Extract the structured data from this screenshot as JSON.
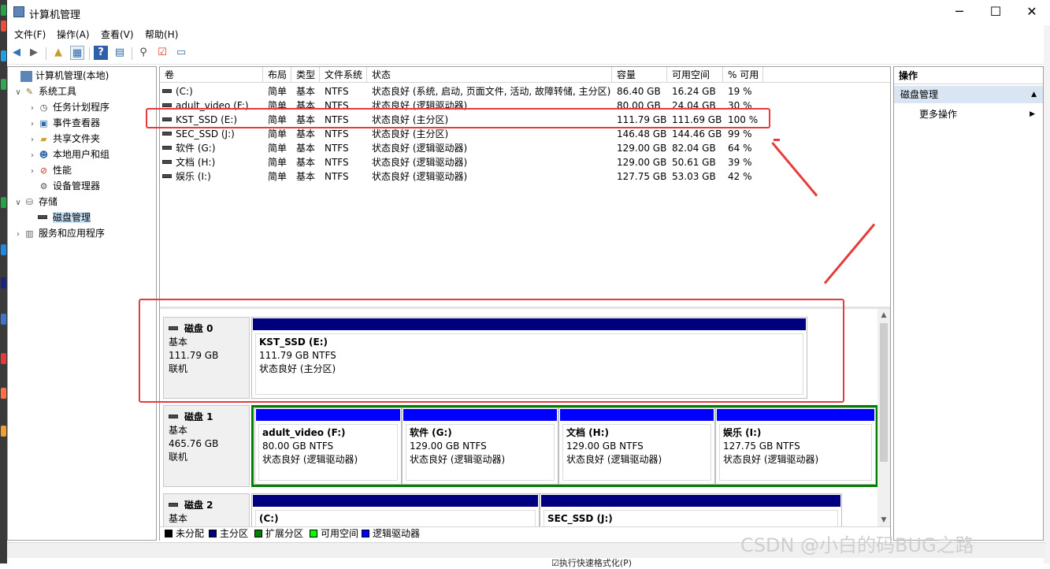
{
  "window": {
    "title": "计算机管理"
  },
  "menu": [
    "文件(F)",
    "操作(A)",
    "查看(V)",
    "帮助(H)"
  ],
  "tree": {
    "root": "计算机管理(本地)",
    "system_tools": "系统工具",
    "task_scheduler": "任务计划程序",
    "event_viewer": "事件查看器",
    "shared_folders": "共享文件夹",
    "local_users": "本地用户和组",
    "performance": "性能",
    "device_manager": "设备管理器",
    "storage": "存储",
    "disk_management": "磁盘管理",
    "services_apps": "服务和应用程序"
  },
  "columns": [
    "卷",
    "布局",
    "类型",
    "文件系统",
    "状态",
    "容量",
    "可用空间",
    "% 可用"
  ],
  "volumes": [
    {
      "name": "(C:)",
      "layout": "简单",
      "type": "基本",
      "fs": "NTFS",
      "status": "状态良好 (系统, 启动, 页面文件, 活动, 故障转储, 主分区)",
      "capacity": "86.40 GB",
      "free": "16.24 GB",
      "pct": "19 %"
    },
    {
      "name": "adult_video (F:)",
      "layout": "简单",
      "type": "基本",
      "fs": "NTFS",
      "status": "状态良好 (逻辑驱动器)",
      "capacity": "80.00 GB",
      "free": "24.04 GB",
      "pct": "30 %"
    },
    {
      "name": "KST_SSD (E:)",
      "layout": "简单",
      "type": "基本",
      "fs": "NTFS",
      "status": "状态良好 (主分区)",
      "capacity": "111.79 GB",
      "free": "111.69 GB",
      "pct": "100 %"
    },
    {
      "name": "SEC_SSD (J:)",
      "layout": "简单",
      "type": "基本",
      "fs": "NTFS",
      "status": "状态良好 (主分区)",
      "capacity": "146.48 GB",
      "free": "144.46 GB",
      "pct": "99 %"
    },
    {
      "name": "软件 (G:)",
      "layout": "简单",
      "type": "基本",
      "fs": "NTFS",
      "status": "状态良好 (逻辑驱动器)",
      "capacity": "129.00 GB",
      "free": "82.04 GB",
      "pct": "64 %"
    },
    {
      "name": "文档 (H:)",
      "layout": "简单",
      "type": "基本",
      "fs": "NTFS",
      "status": "状态良好 (逻辑驱动器)",
      "capacity": "129.00 GB",
      "free": "50.61 GB",
      "pct": "39 %"
    },
    {
      "name": "娱乐 (I:)",
      "layout": "简单",
      "type": "基本",
      "fs": "NTFS",
      "status": "状态良好 (逻辑驱动器)",
      "capacity": "127.75 GB",
      "free": "53.03 GB",
      "pct": "42 %"
    }
  ],
  "disks": [
    {
      "name": "磁盘 0",
      "type": "基本",
      "size": "111.79 GB",
      "state": "联机",
      "partitions": [
        {
          "name": "KST_SSD  (E:)",
          "size": "111.79 GB NTFS",
          "status": "状态良好 (主分区)"
        }
      ]
    },
    {
      "name": "磁盘 1",
      "type": "基本",
      "size": "465.76 GB",
      "state": "联机",
      "partitions": [
        {
          "name": "adult_video  (F:)",
          "size": "80.00 GB NTFS",
          "status": "状态良好 (逻辑驱动器)"
        },
        {
          "name": "软件  (G:)",
          "size": "129.00 GB NTFS",
          "status": "状态良好 (逻辑驱动器)"
        },
        {
          "name": "文档  (H:)",
          "size": "129.00 GB NTFS",
          "status": "状态良好 (逻辑驱动器)"
        },
        {
          "name": "娱乐  (I:)",
          "size": "127.75 GB NTFS",
          "status": "状态良好 (逻辑驱动器)"
        }
      ]
    },
    {
      "name": "磁盘 2",
      "type": "基本",
      "partitions": [
        {
          "name": "(C:)"
        },
        {
          "name": "SEC_SSD  (J:)"
        }
      ]
    }
  ],
  "legend": [
    {
      "label": "未分配",
      "color": "#000000"
    },
    {
      "label": "主分区",
      "color": "#00007f"
    },
    {
      "label": "扩展分区",
      "color": "#007f00"
    },
    {
      "label": "可用空间",
      "color": "#00ff00"
    },
    {
      "label": "逻辑驱动器",
      "color": "#0000ff"
    }
  ],
  "actions": {
    "header": "操作",
    "section": "磁盘管理",
    "more": "更多操作"
  },
  "colors": {
    "primary": "#00007f",
    "logical": "#0000ff",
    "extended": "#007f00",
    "highlight": "#e53b3b",
    "selection": "#cce4f7",
    "action_section": "#d9e5f3"
  },
  "watermark": "CSDN @小白的码BUG之路",
  "behind_text": "☑执行快速格式化(P)"
}
